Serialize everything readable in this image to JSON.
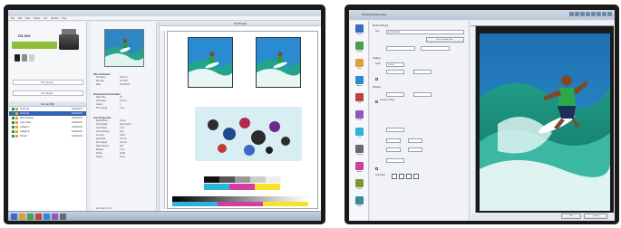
{
  "left_window": {
    "title": "",
    "menu": [
      "File",
      "Edit",
      "View",
      "Printer",
      "Job",
      "Window",
      "Help"
    ],
    "printer_name": "DS-600",
    "fields": [
      "Print Queue",
      "Print Media"
    ],
    "job_list": {
      "header": "Job List (3/6)",
      "rows": [
        {
          "name": "Surfer (1)",
          "date": "2010/12/21"
        },
        {
          "name": "Surfer (2)",
          "date": "2010/12/21"
        },
        {
          "name": "Wave Sample",
          "date": "2010/12/21"
        },
        {
          "name": "Color Chart",
          "date": "2010/12/21"
        },
        {
          "name": "Collage A",
          "date": "2010/12/21"
        },
        {
          "name": "Collage B",
          "date": "2010/12/21"
        },
        {
          "name": "Portrait",
          "date": "2010/12/21"
        }
      ]
    },
    "info": {
      "sections": [
        {
          "head": "File Attributes",
          "rows": [
            [
              "File Name",
              "Surfer.tif"
            ],
            [
              "File Size",
              "24.6 MB"
            ],
            [
              "Date",
              "2010/12/21"
            ]
          ]
        },
        {
          "head": "Document Information",
          "rows": [
            [
              "Page Size",
              "A3"
            ],
            [
              "Orientation",
              "Portrait"
            ],
            [
              "Copies",
              "1"
            ],
            [
              "Print Layout",
              "N-up"
            ]
          ]
        },
        {
          "head": "Job Properties",
          "rows": [
            [
              "Media Name",
              "Glossy"
            ],
            [
              "Print Quality",
              "High Quality"
            ],
            [
              "Color Mode",
              "Color"
            ],
            [
              "Color Settings",
              "Auto"
            ],
            [
              "Ink Limit",
              "100%"
            ],
            [
              "Resolution",
              "720 dpi"
            ],
            [
              "Print Speed",
              "Normal"
            ],
            [
              "Paper Source",
              "Roll"
            ],
            [
              "Margins",
              "3 mm"
            ],
            [
              "Profile",
              "sRGB"
            ],
            [
              "Output",
              "Printer"
            ]
          ]
        }
      ],
      "page_count": "Job Count: 1 of 1"
    },
    "preview_header": "Job Preview",
    "status": "Page 1 of 1"
  },
  "right_window": {
    "title": "Printing Preferences",
    "nav_items": [
      "Layout",
      "Quality",
      "Color",
      "Adjust",
      "Job",
      "Profile",
      "Ink",
      "Scaling",
      "Media",
      "Option",
      "Help"
    ],
    "media": {
      "group": "Media Settings",
      "size_label": "Size",
      "size_value": "A3 (297x420)",
      "custom_button": "User Defined Size..."
    },
    "scaling": {
      "group": "Scaling",
      "scale_label": "Scale",
      "scale_value": "100.00"
    },
    "position": {
      "group": "Position",
      "center_label": "Center on Page"
    },
    "orientation_label": "Orientation",
    "buttons": {
      "ok": "OK",
      "cancel": "Cancel"
    }
  },
  "colors": {
    "accent_blue": "#3162b8",
    "ink_green": "#8fbf3a",
    "window_frame": "#1a1a1a"
  }
}
